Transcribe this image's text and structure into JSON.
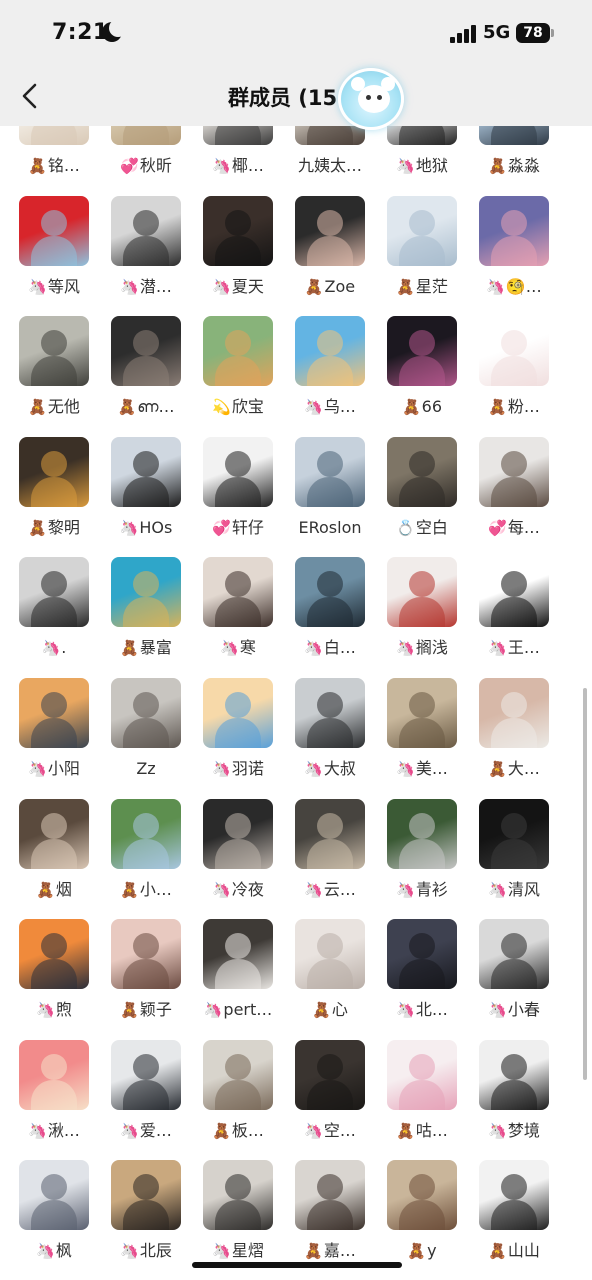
{
  "status": {
    "time": "7:21",
    "network": "5G",
    "battery": "78"
  },
  "nav": {
    "title": "群成员 (15"
  },
  "badges": {
    "bear": "🧸",
    "unicorn": "🦄",
    "heart": "💞",
    "comet": "💫",
    "ring": "💍"
  },
  "members": [
    {
      "name": "铭…",
      "badge": "bear",
      "colors": [
        "#f3eee6",
        "#d9c9b6"
      ]
    },
    {
      "name": "秋昕",
      "badge": "heart",
      "colors": [
        "#d9cbb0",
        "#b59d7a"
      ]
    },
    {
      "name": "椰…",
      "badge": "unicorn",
      "colors": [
        "#e8e4df",
        "#3a3a3a"
      ]
    },
    {
      "name": "九姨太…",
      "badge": "",
      "colors": [
        "#cfc7bd",
        "#4a3f38"
      ]
    },
    {
      "name": "地狱",
      "badge": "unicorn",
      "colors": [
        "#f1f1f1",
        "#222222"
      ]
    },
    {
      "name": "淼淼",
      "badge": "bear",
      "colors": [
        "#a9c1d6",
        "#2f3a46"
      ]
    },
    {
      "name": "等风",
      "badge": "unicorn",
      "colors": [
        "#d8252b",
        "#8ec3df"
      ]
    },
    {
      "name": "潜…",
      "badge": "unicorn",
      "colors": [
        "#d6d6d6",
        "#2b2b2b"
      ]
    },
    {
      "name": "夏天",
      "badge": "unicorn",
      "colors": [
        "#3a2f2a",
        "#141414"
      ]
    },
    {
      "name": "Zoe",
      "badge": "bear",
      "colors": [
        "#2b2b2b",
        "#d9b6a8"
      ]
    },
    {
      "name": "星茫",
      "badge": "bear",
      "colors": [
        "#dfe7ee",
        "#a8bccd"
      ]
    },
    {
      "name": "🧐…",
      "badge": "unicorn",
      "colors": [
        "#6b6aa8",
        "#e6a0b2"
      ]
    },
    {
      "name": "无他",
      "badge": "bear",
      "colors": [
        "#b9b9b0",
        "#3f3f3a"
      ]
    },
    {
      "name": "ണ…",
      "badge": "bear",
      "colors": [
        "#2d2d2d",
        "#8a7d75"
      ]
    },
    {
      "name": "欣宝",
      "badge": "comet",
      "colors": [
        "#88b37a",
        "#e1a35b"
      ]
    },
    {
      "name": "乌…",
      "badge": "unicorn",
      "colors": [
        "#63b4e3",
        "#f1c27a"
      ]
    },
    {
      "name": "66",
      "badge": "bear",
      "colors": [
        "#1c1820",
        "#b0568a"
      ]
    },
    {
      "name": "粉…",
      "badge": "bear",
      "colors": [
        "#ffffff",
        "#f0dede"
      ]
    },
    {
      "name": "黎明",
      "badge": "bear",
      "colors": [
        "#3b3026",
        "#d99a3d"
      ]
    },
    {
      "name": "HOs",
      "badge": "unicorn",
      "colors": [
        "#cfd7e0",
        "#1b1b1b"
      ]
    },
    {
      "name": "轩仔",
      "badge": "heart",
      "colors": [
        "#f2f2f2",
        "#202020"
      ]
    },
    {
      "name": "ERoslon",
      "badge": "",
      "colors": [
        "#c6d1dc",
        "#4d6478"
      ]
    },
    {
      "name": "空白",
      "badge": "ring",
      "colors": [
        "#7e7566",
        "#2e2a26"
      ]
    },
    {
      "name": "每…",
      "badge": "heart",
      "colors": [
        "#e8e6e4",
        "#5a4a40"
      ]
    },
    {
      "name": ".",
      "badge": "unicorn",
      "colors": [
        "#d4d4d4",
        "#262626"
      ]
    },
    {
      "name": "暴富",
      "badge": "bear",
      "colors": [
        "#2fa6c9",
        "#d7b35a"
      ]
    },
    {
      "name": "寒",
      "badge": "unicorn",
      "colors": [
        "#e2d8d0",
        "#3d2f2a"
      ]
    },
    {
      "name": "白…",
      "badge": "unicorn",
      "colors": [
        "#6d8ea3",
        "#1f2a33"
      ]
    },
    {
      "name": "搁浅",
      "badge": "unicorn",
      "colors": [
        "#f1ecea",
        "#b5362f"
      ]
    },
    {
      "name": "王…",
      "badge": "unicorn",
      "colors": [
        "#ffffff",
        "#101010"
      ]
    },
    {
      "name": "小阳",
      "badge": "unicorn",
      "colors": [
        "#e9a760",
        "#3a4450"
      ]
    },
    {
      "name": "Zz",
      "badge": "",
      "colors": [
        "#c8c5c0",
        "#5d5650"
      ]
    },
    {
      "name": "羽诺",
      "badge": "unicorn",
      "colors": [
        "#f7d9a9",
        "#59a0d9"
      ]
    },
    {
      "name": "大叔",
      "badge": "unicorn",
      "colors": [
        "#c9cdd0",
        "#2a2c2e"
      ]
    },
    {
      "name": "美…",
      "badge": "unicorn",
      "colors": [
        "#c8b79c",
        "#6a5a44"
      ]
    },
    {
      "name": "大…",
      "badge": "bear",
      "colors": [
        "#d7b8a8",
        "#eceae6"
      ]
    },
    {
      "name": "烟",
      "badge": "bear",
      "colors": [
        "#5a4a3d",
        "#d9c6b4"
      ]
    },
    {
      "name": "小…",
      "badge": "bear",
      "colors": [
        "#5d8f4f",
        "#a8c6e0"
      ]
    },
    {
      "name": "冷夜",
      "badge": "unicorn",
      "colors": [
        "#2a2a2a",
        "#b9b0a8"
      ]
    },
    {
      "name": "云…",
      "badge": "unicorn",
      "colors": [
        "#47443f",
        "#c7b9a6"
      ]
    },
    {
      "name": "青衫",
      "badge": "unicorn",
      "colors": [
        "#3b5a35",
        "#c5c5c5"
      ]
    },
    {
      "name": "清风",
      "badge": "unicorn",
      "colors": [
        "#141414",
        "#3a3a3a"
      ]
    },
    {
      "name": "煦",
      "badge": "unicorn",
      "colors": [
        "#f08a3b",
        "#2c2f3b"
      ]
    },
    {
      "name": "颖子",
      "badge": "bear",
      "colors": [
        "#e8c9c0",
        "#6a4a40"
      ]
    },
    {
      "name": "pert…",
      "badge": "unicorn",
      "colors": [
        "#3e3a36",
        "#e9e6e2"
      ]
    },
    {
      "name": "心",
      "badge": "bear",
      "colors": [
        "#e9e3df",
        "#b9aea7"
      ]
    },
    {
      "name": "北…",
      "badge": "unicorn",
      "colors": [
        "#3e4150",
        "#17181d"
      ]
    },
    {
      "name": "小春",
      "badge": "unicorn",
      "colors": [
        "#d9d9d9",
        "#262626"
      ]
    },
    {
      "name": "湫…",
      "badge": "unicorn",
      "colors": [
        "#f28b8b",
        "#f6e0c8"
      ]
    },
    {
      "name": "爱…",
      "badge": "unicorn",
      "colors": [
        "#e6e8ea",
        "#262a30"
      ]
    },
    {
      "name": "板…",
      "badge": "bear",
      "colors": [
        "#d8d4cc",
        "#7a6a5a"
      ]
    },
    {
      "name": "空…",
      "badge": "unicorn",
      "colors": [
        "#3a3430",
        "#1a1816"
      ]
    },
    {
      "name": "咕…",
      "badge": "bear",
      "colors": [
        "#f6eef0",
        "#e6a2b8"
      ]
    },
    {
      "name": "梦境",
      "badge": "unicorn",
      "colors": [
        "#efefef",
        "#1a1a1a"
      ]
    },
    {
      "name": "枫",
      "badge": "unicorn",
      "colors": [
        "#e0e3e8",
        "#5a6070"
      ]
    },
    {
      "name": "北辰",
      "badge": "unicorn",
      "colors": [
        "#c9a87e",
        "#2a2420"
      ]
    },
    {
      "name": "星熠",
      "badge": "unicorn",
      "colors": [
        "#d6d2cc",
        "#2e2c2a"
      ]
    },
    {
      "name": "嘉…",
      "badge": "bear",
      "colors": [
        "#d9d5d0",
        "#3a302a"
      ]
    },
    {
      "name": "y",
      "badge": "bear",
      "colors": [
        "#c9b59a",
        "#6d4f3a"
      ]
    },
    {
      "name": "山山",
      "badge": "bear",
      "colors": [
        "#f2f2f2",
        "#1e1e1e"
      ]
    }
  ]
}
